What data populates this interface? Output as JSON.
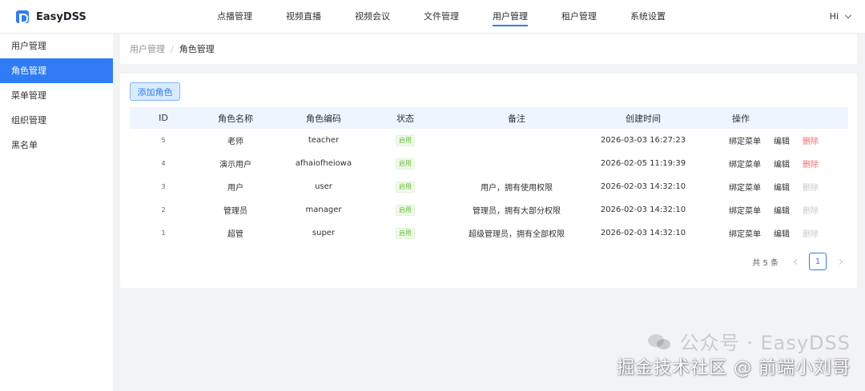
{
  "app": {
    "name": "EasyDSS"
  },
  "topnav": {
    "items": [
      "点播管理",
      "视频直播",
      "视频会议",
      "文件管理",
      "用户管理",
      "租户管理",
      "系统设置"
    ],
    "active_index": 4
  },
  "user": {
    "greeting": "Hi"
  },
  "sidebar": {
    "items": [
      "用户管理",
      "角色管理",
      "菜单管理",
      "组织管理",
      "黑名单"
    ],
    "active_index": 1
  },
  "breadcrumb": {
    "parent": "用户管理",
    "separator": "/",
    "current": "角色管理"
  },
  "toolbar": {
    "add_label": "添加角色"
  },
  "table": {
    "headers": {
      "id": "ID",
      "name": "角色名称",
      "code": "角色编码",
      "status": "状态",
      "note": "备注",
      "created": "创建时间",
      "actions": "操作"
    },
    "rows": [
      {
        "id": "5",
        "name": "老师",
        "code": "teacher",
        "status": "启用",
        "note": "",
        "created": "2026-03-03 16:27:23",
        "bind": "绑定菜单",
        "edit": "编辑",
        "delete": "删除",
        "delete_enabled": true
      },
      {
        "id": "4",
        "name": "演示用户",
        "code": "afhaiofheiowa",
        "status": "启用",
        "note": "",
        "created": "2026-02-05 11:19:39",
        "bind": "绑定菜单",
        "edit": "编辑",
        "delete": "删除",
        "delete_enabled": true
      },
      {
        "id": "3",
        "name": "用户",
        "code": "user",
        "status": "启用",
        "note": "用户，拥有使用权限",
        "created": "2026-02-03 14:32:10",
        "bind": "绑定菜单",
        "edit": "编辑",
        "delete": "删除",
        "delete_enabled": false
      },
      {
        "id": "2",
        "name": "管理员",
        "code": "manager",
        "status": "启用",
        "note": "管理员，拥有大部分权限",
        "created": "2026-02-03 14:32:10",
        "bind": "绑定菜单",
        "edit": "编辑",
        "delete": "删除",
        "delete_enabled": false
      },
      {
        "id": "1",
        "name": "超管",
        "code": "super",
        "status": "启用",
        "note": "超级管理员，拥有全部权限",
        "created": "2026-02-03 14:32:10",
        "bind": "绑定菜单",
        "edit": "编辑",
        "delete": "删除",
        "delete_enabled": false
      }
    ]
  },
  "pagination": {
    "total_text": "共 5 条",
    "current_page": "1"
  },
  "watermark": {
    "line1": "公众号 · EasyDSS",
    "line2": "掘金技术社区 @ 前端小刘哥"
  },
  "colors": {
    "primary": "#2f7cf6",
    "danger": "#f56c6c",
    "success": "#67c23a",
    "disabled": "#c8c9cc"
  }
}
